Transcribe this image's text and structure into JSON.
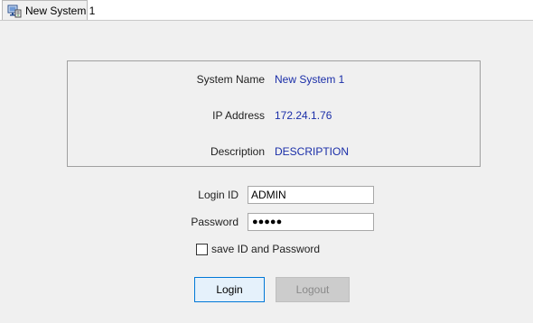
{
  "tab": {
    "label": "New System 1",
    "icon": "network-system-icon"
  },
  "system_info": {
    "name_label": "System Name",
    "name_value": "New System 1",
    "ip_label": "IP Address",
    "ip_value": "172.24.1.76",
    "description_label": "Description",
    "description_value": "DESCRIPTION",
    "value_color": "#1a2ea8"
  },
  "login_form": {
    "login_id_label": "Login ID",
    "login_id_value": "ADMIN",
    "password_label": "Password",
    "password_masked": "●●●●●",
    "save_checkbox_label": "save ID and Password",
    "save_checked": false
  },
  "buttons": {
    "login_label": "Login",
    "logout_label": "Logout",
    "logout_enabled": false
  }
}
